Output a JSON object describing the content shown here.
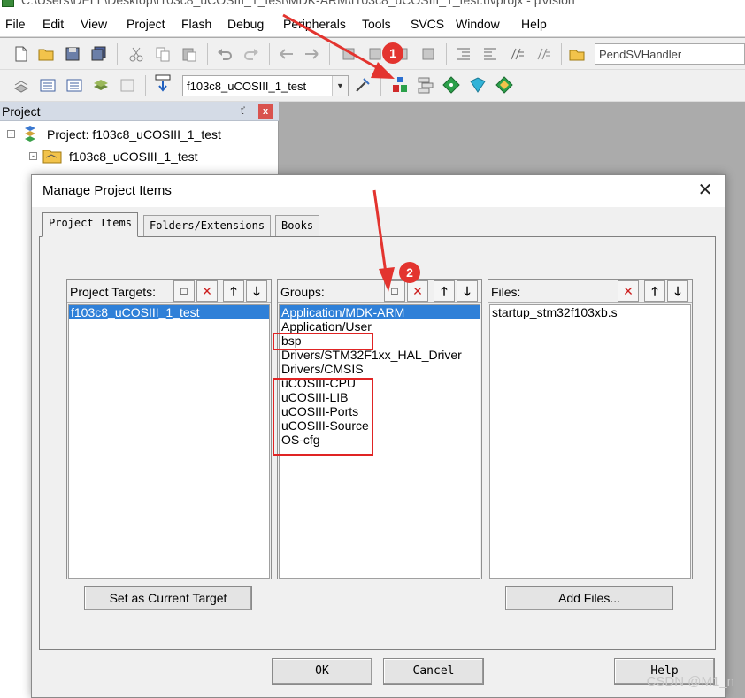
{
  "window": {
    "title": "C:\\Users\\DELL\\Desktop\\f103c8_uCOSIII_1_test\\MDK-ARM\\f103c8_uCOSIII_1_test.uvprojx - µVision"
  },
  "menu": [
    "File",
    "Edit",
    "View",
    "Project",
    "Flash",
    "Debug",
    "Peripherals",
    "Tools",
    "SVCS",
    "Window",
    "Help"
  ],
  "toolbar1": {
    "function_combo": "PendSVHandler"
  },
  "toolbar2": {
    "target_combo": "f103c8_uCOSIII_1_test"
  },
  "project_pane": {
    "title": "Project",
    "pin": "ť",
    "close": "x",
    "root": "Project: f103c8_uCOSIII_1_test",
    "target": "f103c8_uCOSIII_1_test",
    "target_expander": "⊟",
    "root_expander": "⊟"
  },
  "dialog": {
    "title": "Manage Project Items",
    "close": "✕",
    "tabs": [
      "Project Items",
      "Folders/Extensions",
      "Books"
    ],
    "targets": {
      "label": "Project Targets:",
      "items": [
        "f103c8_uCOSIII_1_test"
      ],
      "selected": 0
    },
    "groups": {
      "label": "Groups:",
      "items": [
        "Application/MDK-ARM",
        "Application/User",
        "bsp",
        "Drivers/STM32F1xx_HAL_Driver",
        "Drivers/CMSIS",
        "uCOSIII-CPU",
        "uCOSIII-LIB",
        "uCOSIII-Ports",
        "uCOSIII-Source",
        "OS-cfg"
      ],
      "selected": 0
    },
    "files": {
      "label": "Files:",
      "items": [
        "startup_stm32f103xb.s"
      ]
    },
    "set_current_target": "Set as Current Target",
    "add_files": "Add Files...",
    "ok": "OK",
    "cancel": "Cancel",
    "help": "Help"
  },
  "annotations": {
    "marker1": "1",
    "marker2": "2",
    "accent_color": "#e3342f"
  },
  "watermark": "CSDN @M1_n"
}
